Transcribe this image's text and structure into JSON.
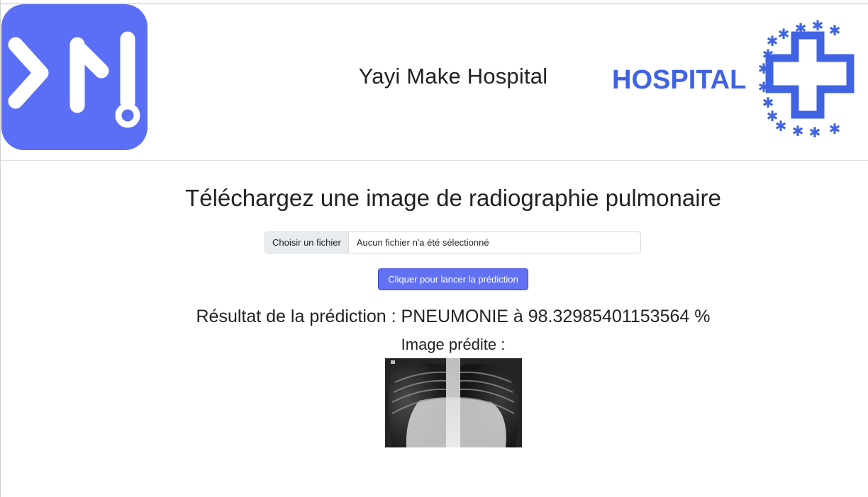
{
  "header": {
    "site_title": "Yayi Make Hospital",
    "hospital_logo_text": "HOSPITAL",
    "brand_color": "#5b6ff6",
    "hospital_color": "#3f63e3"
  },
  "upload": {
    "heading": "Téléchargez une image de radiographie pulmonaire",
    "file_button_label": "Choisir un fichier",
    "file_status": "Aucun fichier n'a été sélectionné",
    "predict_button_label": "Cliquer pour lancer la prédiction"
  },
  "result": {
    "text": "Résultat de la prédiction : PNEUMONIE à 98.32985401153564 %",
    "image_label": "Image prédite :"
  }
}
